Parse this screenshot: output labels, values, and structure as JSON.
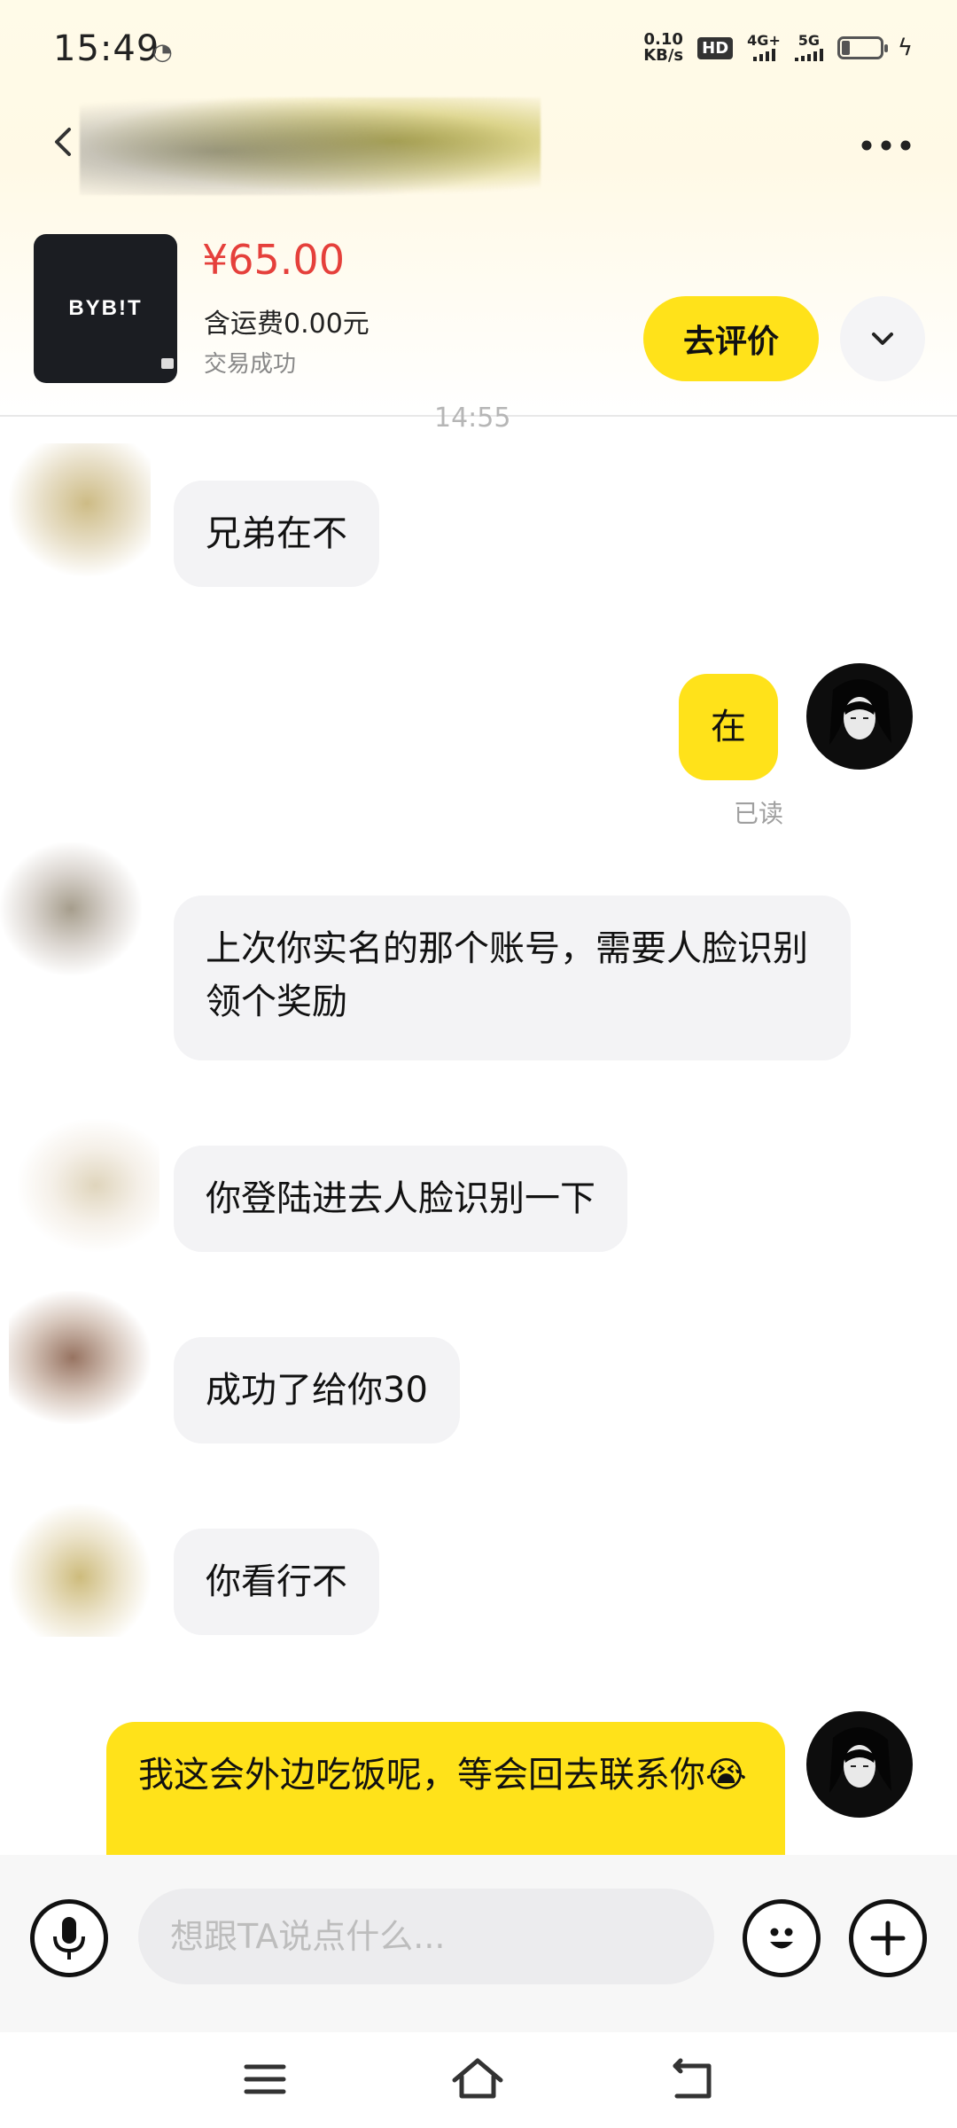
{
  "status_bar": {
    "time": "15:49",
    "net_speed_value": "0.10",
    "net_speed_unit": "KB/s",
    "hd_label": "HD",
    "sim1_label": "4G+",
    "sim2_label": "5G"
  },
  "header": {
    "back_icon": "back-arrow-icon",
    "more_icon": "more-dots-icon"
  },
  "product": {
    "brand_text": "BYB!T",
    "price": "¥65.00",
    "shipping": "含运费0.00元",
    "status": "交易成功",
    "review_button": "去评价",
    "expand_icon": "chevron-down-icon"
  },
  "chat": {
    "timestamp": "14:55",
    "messages": [
      {
        "side": "in",
        "text": "兄弟在不"
      },
      {
        "side": "out",
        "text": "在",
        "read": "已读"
      },
      {
        "side": "in",
        "text": "上次你实名的那个账号，需要人脸识别领个奖励"
      },
      {
        "side": "in",
        "text": "你登陆进去人脸识别一下"
      },
      {
        "side": "in",
        "text": "成功了给你30"
      },
      {
        "side": "in",
        "text": "你看行不"
      },
      {
        "side": "out",
        "text": "我这会外边吃饭呢，等会回去联系你😭"
      }
    ]
  },
  "composer": {
    "placeholder": "想跟TA说点什么...",
    "voice_icon": "microphone-icon",
    "emoji_icon": "emoji-icon",
    "plus_icon": "plus-icon"
  },
  "system_nav": {
    "menu_icon": "menu-icon",
    "home_icon": "home-icon",
    "back_icon": "back-icon"
  },
  "colors": {
    "accent_yellow": "#ffe21a",
    "price_red": "#e5403b",
    "incoming_bubble": "#f3f3f5"
  }
}
